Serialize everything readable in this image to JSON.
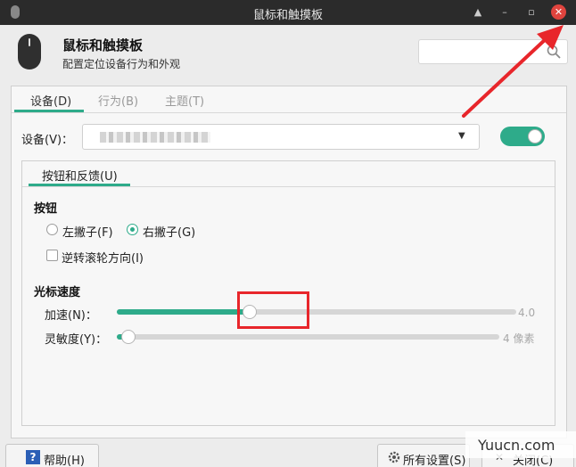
{
  "window": {
    "title": "鼠标和触摸板",
    "controls": {
      "close": "✕"
    }
  },
  "header": {
    "title": "鼠标和触摸板",
    "subtitle": "配置定位设备行为和外观",
    "search": {
      "value": "",
      "placeholder": ""
    }
  },
  "tabs": [
    {
      "label": "设备(D)",
      "active": true
    },
    {
      "label": "行为(B)",
      "active": false
    },
    {
      "label": "主题(T)",
      "active": false
    }
  ],
  "device": {
    "label": "设备(V)：",
    "selected_value": "",
    "enabled": true
  },
  "inner_tabs": [
    {
      "label": "按钮和反馈(U)",
      "active": true
    }
  ],
  "buttons_section": {
    "heading": "按钮",
    "left_handed": {
      "label": "左撇子(F)",
      "checked": false
    },
    "right_handed": {
      "label": "右撇子(G)",
      "checked": true
    },
    "reverse_scroll": {
      "label": "逆转滚轮方向(I)",
      "checked": false
    }
  },
  "pointer_speed": {
    "heading": "光标速度",
    "acceleration": {
      "label": "加速(N)：",
      "value_text": "4.0",
      "value": 4.0,
      "min": 1.0,
      "max": 10.0
    },
    "sensitivity": {
      "label": "灵敏度(Y)：",
      "value_text": "4 像素",
      "value": 4,
      "min": 1,
      "max": 100
    }
  },
  "footer": {
    "help": "帮助(H)",
    "all_settings": "所有设置(S)",
    "close": "关闭(C)"
  },
  "watermark": "Yuucn.com",
  "colors": {
    "accent": "#2eab8a",
    "titlebar": "#2b2b2b",
    "annotation": "#e8262b",
    "close": "#e0443e"
  },
  "icons": [
    "mouse-icon",
    "search-icon",
    "help-icon",
    "settings-icon",
    "close-icon",
    "dropdown-arrow-icon"
  ]
}
